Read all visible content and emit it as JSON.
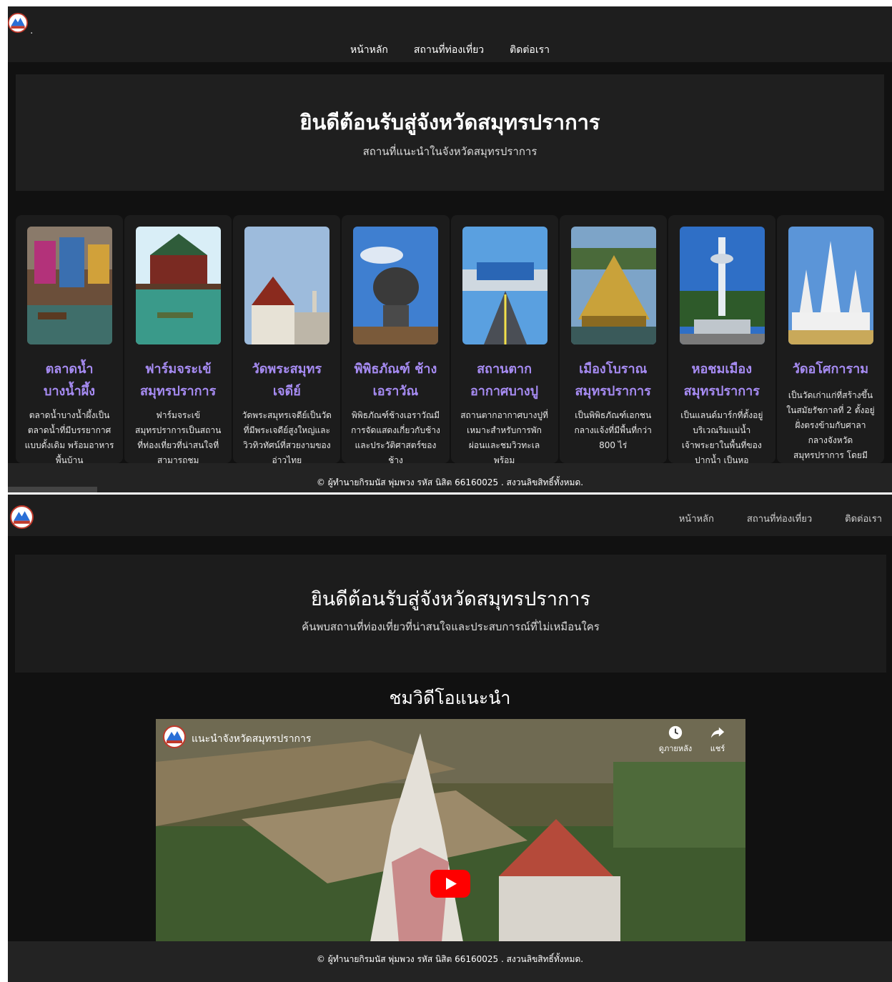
{
  "nav": {
    "home": "หน้าหลัก",
    "attractions": "สถานที่ท่องเที่ยว",
    "contact": "ติดต่อเรา",
    "logo_suffix": "."
  },
  "page1": {
    "hero_title": "ยินดีต้อนรับสู่จังหวัดสมุทรปราการ",
    "hero_subtitle": "สถานที่แนะนำในจังหวัดสมุทรปราการ",
    "cards": [
      {
        "title": "ตลาดน้ำ บางน้ำผึ้ง",
        "desc": "ตลาดน้ำบางน้ำผึ้งเป็นตลาดน้ำที่มีบรรยากาศแบบดั้งเดิม พร้อมอาหารพื้นบ้าน",
        "image_icon": "floating-market-photo"
      },
      {
        "title": "ฟาร์มจระเข้ สมุทรปราการ",
        "desc": "ฟาร์มจระเข้สมุทรปราการเป็นสถานที่ท่องเที่ยวที่น่าสนใจที่สามารถชม",
        "image_icon": "crocodile-farm-photo"
      },
      {
        "title": "วัดพระสมุทร เจดีย์",
        "desc": "วัดพระสมุทรเจดีย์เป็นวัดที่มีพระเจดีย์สูงใหญ่และวิวทิวทัศน์ที่สวยงามของอ่าวไทย",
        "image_icon": "temple-photo"
      },
      {
        "title": "พิพิธภัณฑ์ ช้างเอราวัณ",
        "desc": "พิพิธภัณฑ์ช้างเอราวัณมีการจัดแสดงเกี่ยวกับช้างและประวัติศาสตร์ของช้าง",
        "image_icon": "erawan-elephant-photo"
      },
      {
        "title": "สถานตาก อากาศบางปู",
        "desc": "สถานตากอากาศบางปูที่เหมาะสำหรับการพักผ่อนและชมวิวทะเล พร้อม",
        "image_icon": "bangpu-pier-photo"
      },
      {
        "title": "เมืองโบราณ สมุทรปราการ",
        "desc": "เป็นพิพิธภัณฑ์เอกชนกลางแจ้งที่มีพื้นที่กว่า 800 ไร่",
        "image_icon": "ancient-city-photo"
      },
      {
        "title": "หอชมเมือง สมุทรปราการ",
        "desc": "เป็นแลนด์มาร์กที่ตั้งอยู่บริเวณริมแม่น้ำเจ้าพระยาในพื้นที่ของปากน้ำ เป็นหอ",
        "image_icon": "observation-tower-photo"
      },
      {
        "title": "วัดอโศการาม",
        "desc": "เป็นวัดเก่าแก่ที่สร้างขึ้นในสมัยรัชกาลที่ 2 ตั้งอยู่ฝั่งตรงข้ามกับศาลากลางจังหวัดสมุทรปราการ โดยมี",
        "image_icon": "white-pagoda-photo"
      }
    ],
    "footer": "© ผู้ทำนายกิรมนัส พุ่มพวง รหัส นิสิต 66160025 . สงวนลิขสิทธิ์ทั้งหมด."
  },
  "page2": {
    "hero_title": "ยินดีต้อนรับสู่จังหวัดสมุทรปราการ",
    "hero_subtitle": "ค้นพบสถานที่ท่องเที่ยวที่น่าสนใจและประสบการณ์ที่ไม่เหมือนใคร",
    "video_heading": "ชมวิดีโอแนะนำ",
    "video": {
      "title": "แนะนำจังหวัดสมุทรปราการ",
      "watch_later": "ดูภายหลัง",
      "share": "แชร์"
    },
    "footer": "© ผู้ทำนายกิรมนัส พุ่มพวง รหัส นิสิต 66160025 . สงวนลิขสิทธิ์ทั้งหมด."
  },
  "colors": {
    "background": "#111111",
    "nav": "#1e1e1e",
    "card_title": "#a68bf2",
    "youtube_red": "#ff0000"
  }
}
